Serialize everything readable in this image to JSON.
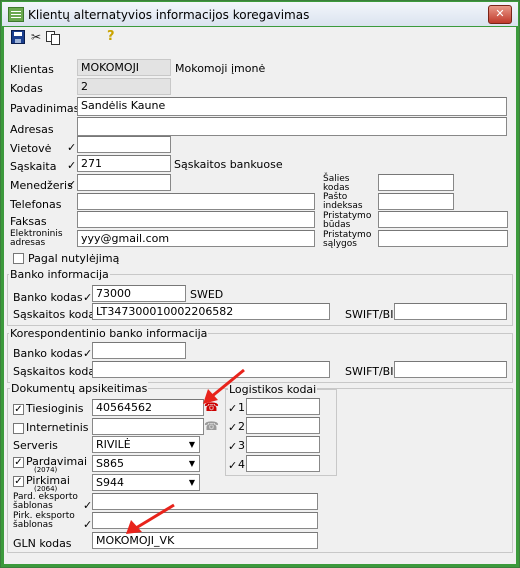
{
  "window": {
    "title": "Klientų alternatyvios informacijos koregavimas",
    "close_label": "✕"
  },
  "toolbar": {
    "save_icon": "floppy-disk-icon",
    "cut_icon": "scissors-icon",
    "copy_icon": "copy-icon",
    "help_icon": "help-key-icon"
  },
  "fields": {
    "klientas": {
      "label": "Klientas",
      "value": "MOKOMOJI",
      "desc": "Mokomoji įmonė"
    },
    "kodas": {
      "label": "Kodas",
      "value": "2"
    },
    "pavadinimas": {
      "label": "Pavadinimas",
      "value": "Sandėlis Kaune"
    },
    "adresas": {
      "label": "Adresas",
      "value": ""
    },
    "vietove": {
      "label": "Vietovė",
      "value": ""
    },
    "saskaita": {
      "label": "Sąskaita",
      "value": "271",
      "desc": "Sąskaitos bankuose"
    },
    "menedzeris": {
      "label": "Menedžeris",
      "value": ""
    },
    "telefonas": {
      "label": "Telefonas",
      "value": ""
    },
    "faksas": {
      "label": "Faksas",
      "value": ""
    },
    "email": {
      "label": "Elektroninis adresas",
      "label_line1": "Elektroninis",
      "label_line2": "adresas",
      "value": "yyy@gmail.com"
    },
    "salies_kodas": {
      "label_line1": "Šalies",
      "label_line2": "kodas",
      "value": ""
    },
    "pasto_indeksas": {
      "label_line1": "Pašto",
      "label_line2": "indeksas",
      "value": ""
    },
    "pristatymo_budas": {
      "label_line1": "Pristatymo",
      "label_line2": "būdas",
      "value": ""
    },
    "pristatymo_salygos": {
      "label_line1": "Pristatymo",
      "label_line2": "sąlygos",
      "value": ""
    },
    "pagal_nutylejima": {
      "label": "Pagal nutylėjimą",
      "checked": false
    }
  },
  "bank": {
    "title": "Banko informacija",
    "kodas_label": "Banko kodas",
    "kodas_value": "73000",
    "kodas_desc": "SWED",
    "saskaitos_label": "Sąskaitos kodas",
    "saskaitos_value": "LT347300010002206582",
    "swift_label": "SWIFT/BIC",
    "swift_value": ""
  },
  "corr_bank": {
    "title": "Korespondentinio banko informacija",
    "kodas_label": "Banko kodas",
    "kodas_value": "",
    "saskaitos_label": "Sąskaitos kodas",
    "saskaitos_value": "",
    "swift_label": "SWIFT/BIC",
    "swift_value": ""
  },
  "docs": {
    "title": "Dokumentų apsikeitimas",
    "tiesioginis": {
      "label": "Tiesioginis",
      "checked": true,
      "value": "40564562"
    },
    "internetinis": {
      "label": "Internetinis",
      "checked": false,
      "value": ""
    },
    "serveris": {
      "label": "Serveris",
      "value": "RIVILĖ"
    },
    "pardavimai": {
      "label": "Pardavimai",
      "sub": "(2074)",
      "checked": true,
      "value": "S865"
    },
    "pirkimai": {
      "label": "Pirkimai",
      "sub": "(2064)",
      "checked": true,
      "value": "S944"
    },
    "pard_eksp": {
      "label_line1": "Pard. eksporto",
      "label_line2": "šablonas",
      "value": ""
    },
    "pirk_eksp": {
      "label_line1": "Pirk. eksporto",
      "label_line2": "šablonas",
      "value": ""
    },
    "gln": {
      "label": "GLN kodas",
      "value": "MOKOMOJI_VK"
    }
  },
  "logistics": {
    "title": "Logistikos kodai",
    "rows": [
      {
        "n": "1",
        "value": ""
      },
      {
        "n": "2",
        "value": ""
      },
      {
        "n": "3",
        "value": ""
      },
      {
        "n": "4",
        "value": ""
      }
    ]
  },
  "checkmark": "✓",
  "arrow_color": "#e8231b"
}
